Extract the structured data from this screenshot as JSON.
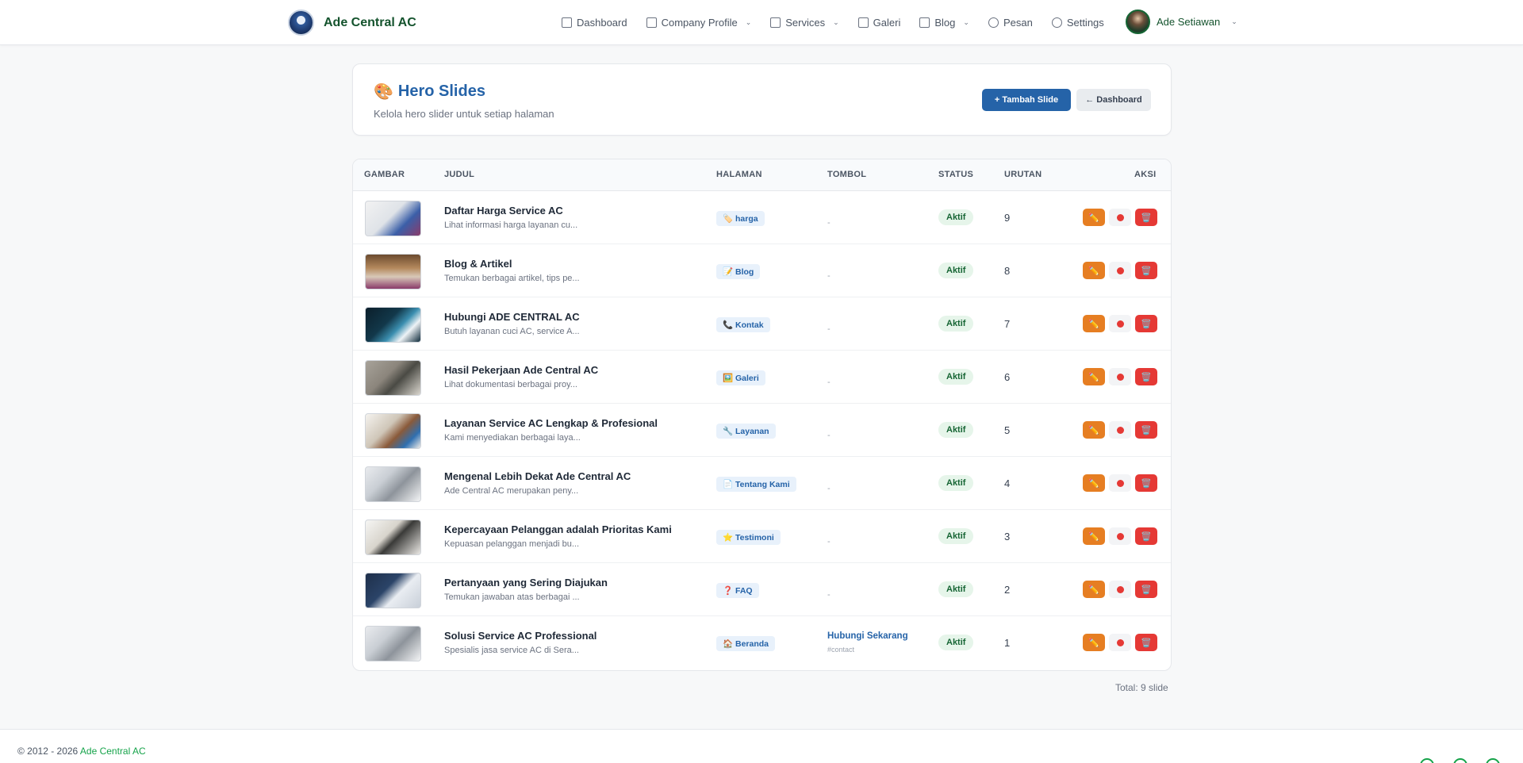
{
  "navbar": {
    "brand": "Ade Central AC",
    "items": [
      {
        "label": "Dashboard",
        "icon": "dashboard-icon",
        "dropdown": false
      },
      {
        "label": "Company Profile",
        "icon": "clipboard-icon",
        "dropdown": true
      },
      {
        "label": "Services",
        "icon": "briefcase-icon",
        "dropdown": true
      },
      {
        "label": "Galeri",
        "icon": "image-icon",
        "dropdown": false
      },
      {
        "label": "Blog",
        "icon": "document-icon",
        "dropdown": true
      },
      {
        "label": "Pesan",
        "icon": "phone-icon",
        "dropdown": false
      },
      {
        "label": "Settings",
        "icon": "gear-icon",
        "dropdown": false
      }
    ],
    "user": "Ade Setiawan"
  },
  "header": {
    "emoji": "🎨",
    "title": "Hero Slides",
    "subtitle": "Kelola hero slider untuk setiap halaman",
    "add_button": "+ Tambah Slide",
    "back_button": "← Dashboard"
  },
  "table": {
    "columns": [
      "GAMBAR",
      "JUDUL",
      "HALAMAN",
      "TOMBOL",
      "STATUS",
      "URUTAN",
      "AKSI"
    ],
    "rows": [
      {
        "title": "Daftar Harga Service AC",
        "desc": "Lihat informasi harga layanan cu...",
        "page": "🏷️ harga",
        "button_label": "-",
        "button_link": "",
        "status": "Aktif",
        "order": "9"
      },
      {
        "title": "Blog & Artikel",
        "desc": "Temukan berbagai artikel, tips pe...",
        "page": "📝 Blog",
        "button_label": "-",
        "button_link": "",
        "status": "Aktif",
        "order": "8"
      },
      {
        "title": "Hubungi ADE CENTRAL AC",
        "desc": "Butuh layanan cuci AC, service A...",
        "page": "📞 Kontak",
        "button_label": "-",
        "button_link": "",
        "status": "Aktif",
        "order": "7"
      },
      {
        "title": "Hasil Pekerjaan Ade Central AC",
        "desc": "Lihat dokumentasi berbagai proy...",
        "page": "🖼️ Galeri",
        "button_label": "-",
        "button_link": "",
        "status": "Aktif",
        "order": "6"
      },
      {
        "title": "Layanan Service AC Lengkap & Profesional",
        "desc": "Kami menyediakan berbagai laya...",
        "page": "🔧 Layanan",
        "button_label": "-",
        "button_link": "",
        "status": "Aktif",
        "order": "5"
      },
      {
        "title": "Mengenal Lebih Dekat Ade Central AC",
        "desc": "Ade Central AC merupakan peny...",
        "page": "📄 Tentang Kami",
        "button_label": "-",
        "button_link": "",
        "status": "Aktif",
        "order": "4"
      },
      {
        "title": "Kepercayaan Pelanggan adalah Prioritas Kami",
        "desc": "Kepuasan pelanggan menjadi bu...",
        "page": "⭐ Testimoni",
        "button_label": "-",
        "button_link": "",
        "status": "Aktif",
        "order": "3"
      },
      {
        "title": "Pertanyaan yang Sering Diajukan",
        "desc": "Temukan jawaban atas berbagai ...",
        "page": "❓ FAQ",
        "button_label": "-",
        "button_link": "",
        "status": "Aktif",
        "order": "2"
      },
      {
        "title": "Solusi Service AC Professional",
        "desc": "Spesialis jasa service AC di Sera...",
        "page": "🏠 Beranda",
        "button_label": "Hubungi Sekarang",
        "button_link": "#contact",
        "status": "Aktif",
        "order": "1"
      }
    ],
    "actions": {
      "edit": "✏️",
      "delete": "🗑️"
    }
  },
  "total": "Total: 9 slide",
  "footer": {
    "copyright": "© 2012 - 2026 ",
    "brand": "Ade Central AC"
  },
  "colors": {
    "primary": "#2563a8",
    "brand_green": "#14532d",
    "edit": "#e67e22",
    "danger": "#e53935",
    "active": "#166534"
  }
}
